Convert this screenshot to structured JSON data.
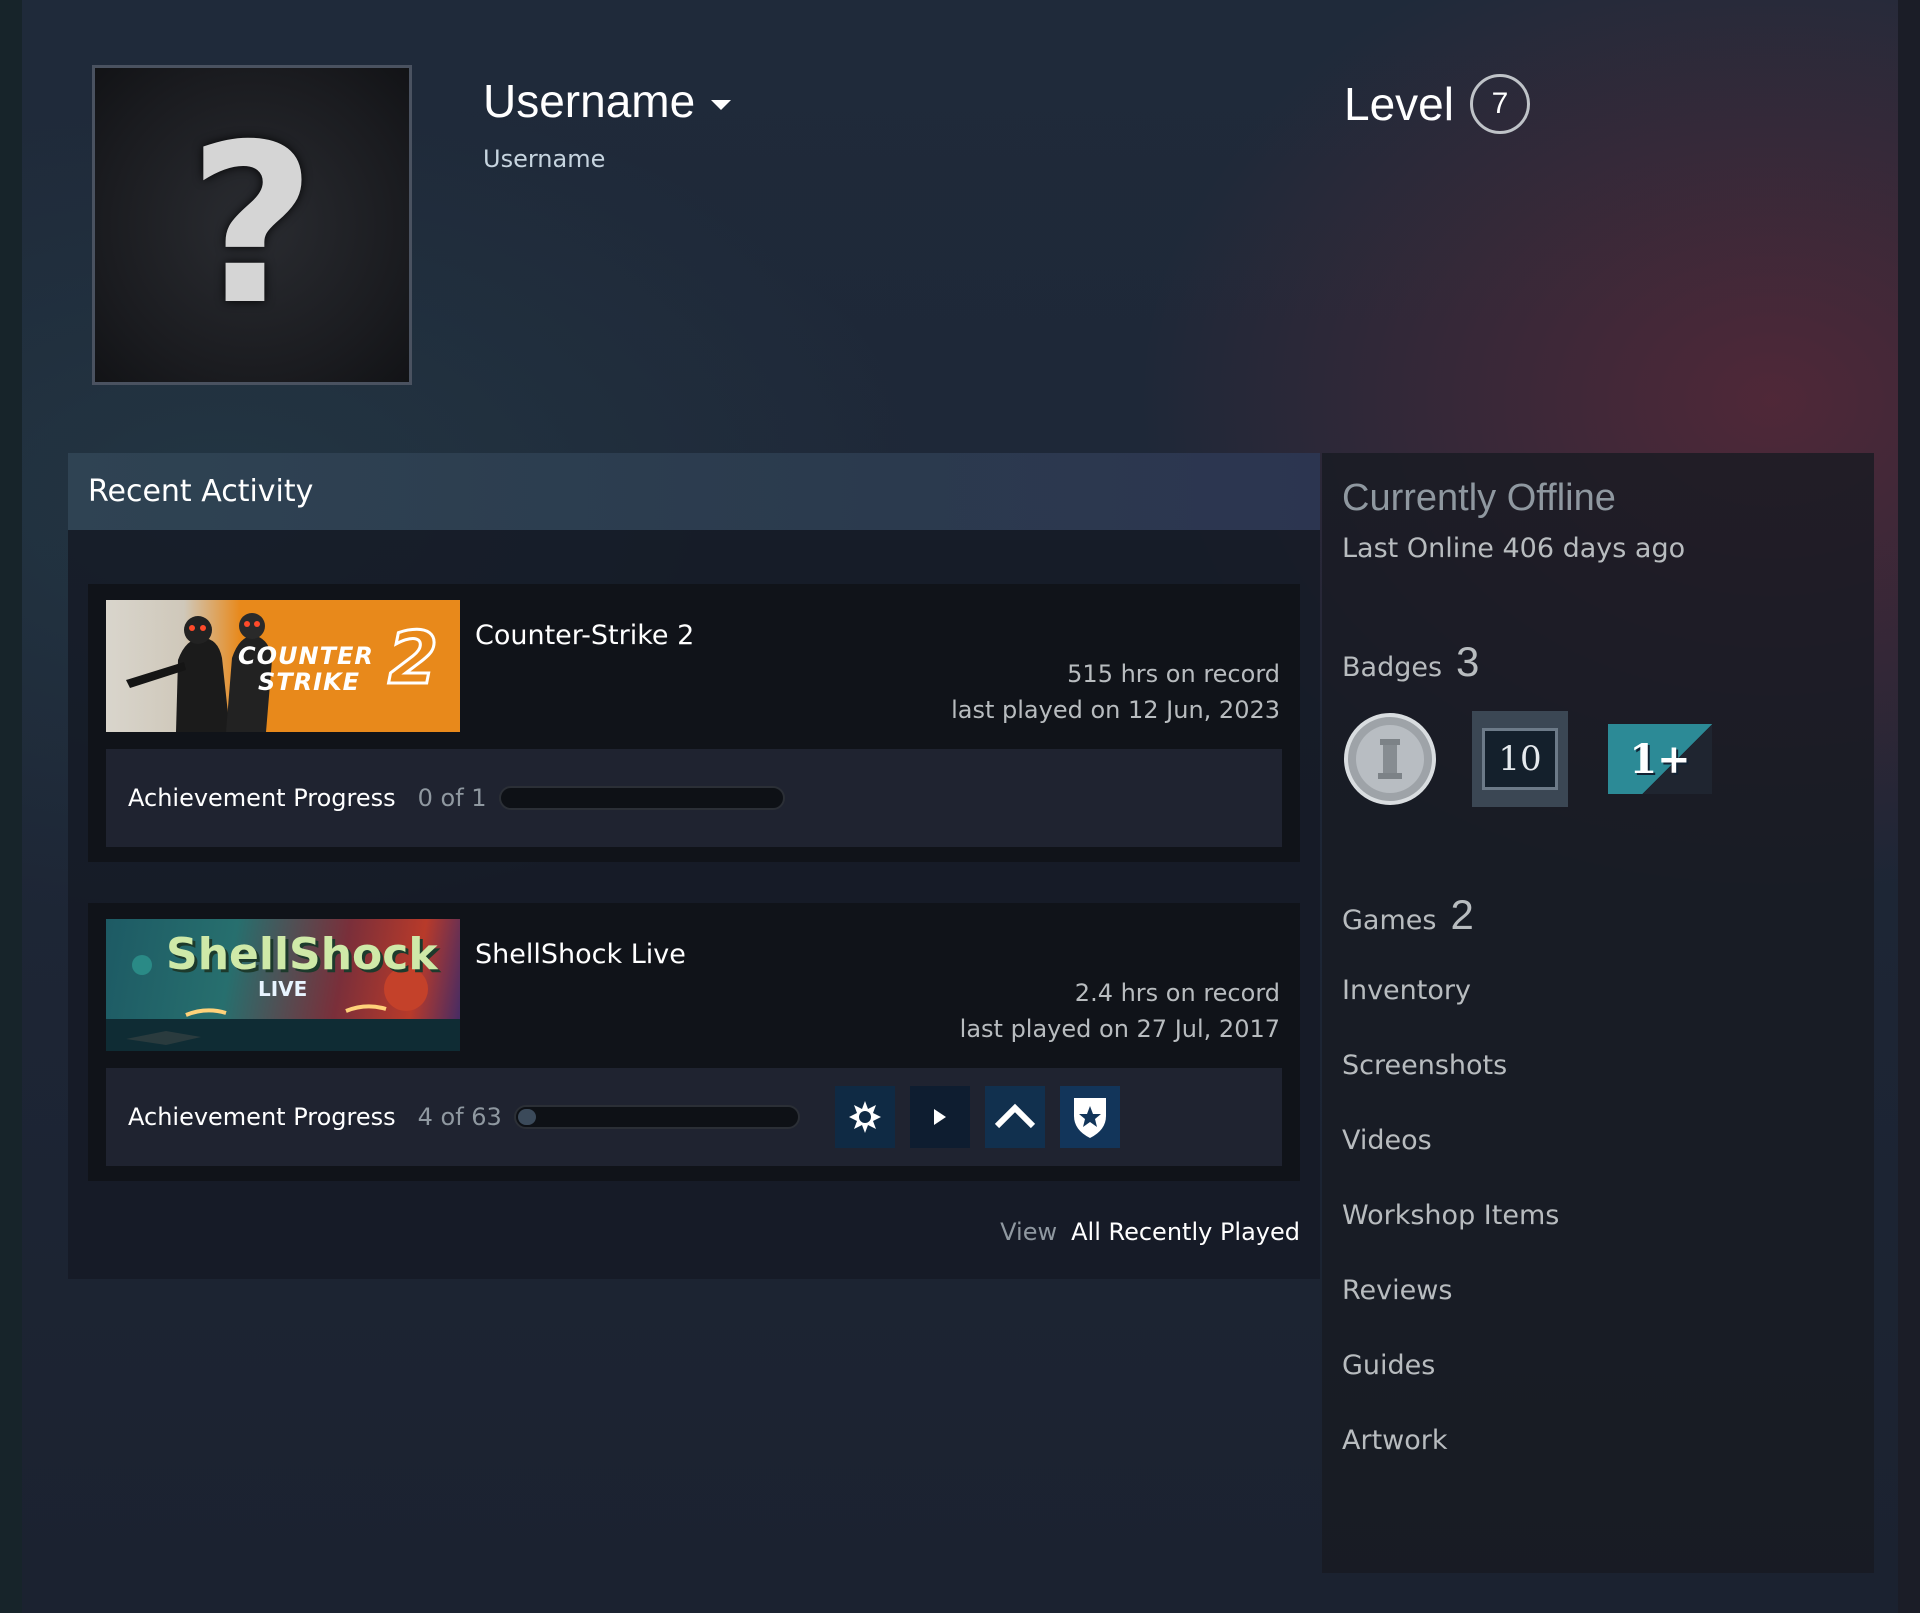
{
  "profile": {
    "username": "Username",
    "real_name": "Username",
    "avatar_glyph": "?",
    "level_label": "Level",
    "level": "7"
  },
  "recent_activity": {
    "title": "Recent Activity",
    "games": [
      {
        "name": "Counter-Strike 2",
        "image_text_1": "COUNTER",
        "image_text_2": "STRIKE",
        "image_text_3": "2",
        "hours": "515 hrs on record",
        "last_played": "last played on 12 Jun, 2023",
        "achievement_label": "Achievement Progress",
        "achievement_count": "0 of 1",
        "achievement_progress": 0
      },
      {
        "name": "ShellShock Live",
        "image_text_1": "ShellShock",
        "image_text_2": "LIVE",
        "hours": "2.4 hrs on record",
        "last_played": "last played on 27 Jul, 2017",
        "achievement_label": "Achievement Progress",
        "achievement_count": "4 of 63",
        "achievement_progress": 0.0635,
        "achievement_icons": [
          "gear-burst-icon",
          "play-arrow-icon",
          "chevron-up-icon",
          "shield-star-icon"
        ]
      }
    ],
    "view_label": "View",
    "view_link": "All Recently Played"
  },
  "sidebar": {
    "status": "Currently Offline",
    "last_online": "Last Online 406 days ago",
    "badges_label": "Badges",
    "badges_count": "3",
    "badges": [
      {
        "icon": "pillar-coin-badge-icon"
      },
      {
        "icon": "years-badge-icon",
        "text": "10"
      },
      {
        "icon": "one-plus-badge-icon",
        "text": "1+"
      }
    ],
    "games_label": "Games",
    "games_count": "2",
    "links": [
      "Inventory",
      "Screenshots",
      "Videos",
      "Workshop Items",
      "Reviews",
      "Guides",
      "Artwork"
    ]
  },
  "colors": {
    "background": "#1e2737",
    "panel": "#101319",
    "accent_header": "#2f4353",
    "text_muted": "#8f98a0",
    "cs2_orange": "#e8891b"
  }
}
